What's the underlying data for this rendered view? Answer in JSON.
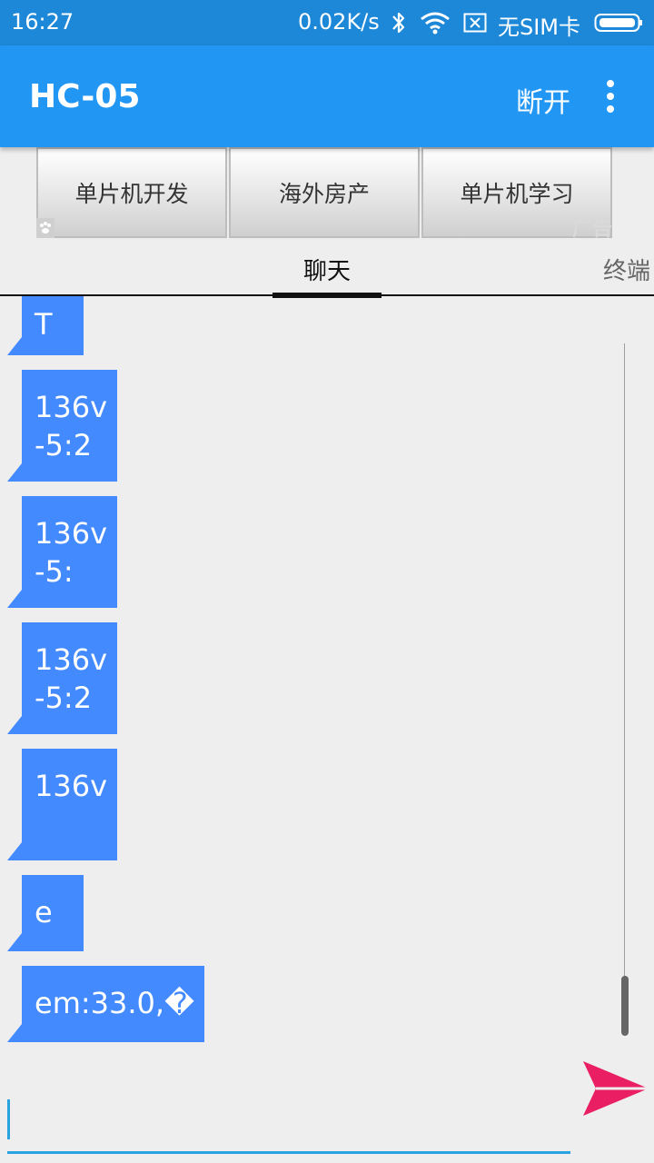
{
  "status_bar": {
    "time": "16:27",
    "network_speed": "0.02K/s",
    "sim_status": "无SIM卡",
    "icons": [
      "bluetooth-icon",
      "wifi-icon",
      "no-sim-icon",
      "battery-icon"
    ]
  },
  "app_bar": {
    "title": "HC-05",
    "disconnect_label": "断开",
    "overflow_icon": "more-vert-icon"
  },
  "ad_banner": {
    "buttons": [
      "单片机开发",
      "海外房产",
      "单片机学习"
    ],
    "tag": "广告"
  },
  "tabs": [
    {
      "label": "聊天",
      "selected": true
    },
    {
      "label": "终端",
      "selected": false
    }
  ],
  "messages": [
    {
      "lines": [
        "T"
      ]
    },
    {
      "lines": [
        "136v",
        "-5:2"
      ]
    },
    {
      "lines": [
        "136v",
        "-5:"
      ]
    },
    {
      "lines": [
        "136v",
        "-5:2"
      ]
    },
    {
      "lines": [
        "136v",
        ""
      ]
    },
    {
      "lines": [
        "e"
      ]
    },
    {
      "lines": [
        "em:33.0,�"
      ]
    }
  ],
  "input": {
    "value": "",
    "placeholder": ""
  },
  "colors": {
    "status_bar": "#1e88d8",
    "app_bar": "#2196f3",
    "bubble": "#448aff",
    "send": "#e91e63",
    "input_accent": "#29a3e0"
  }
}
